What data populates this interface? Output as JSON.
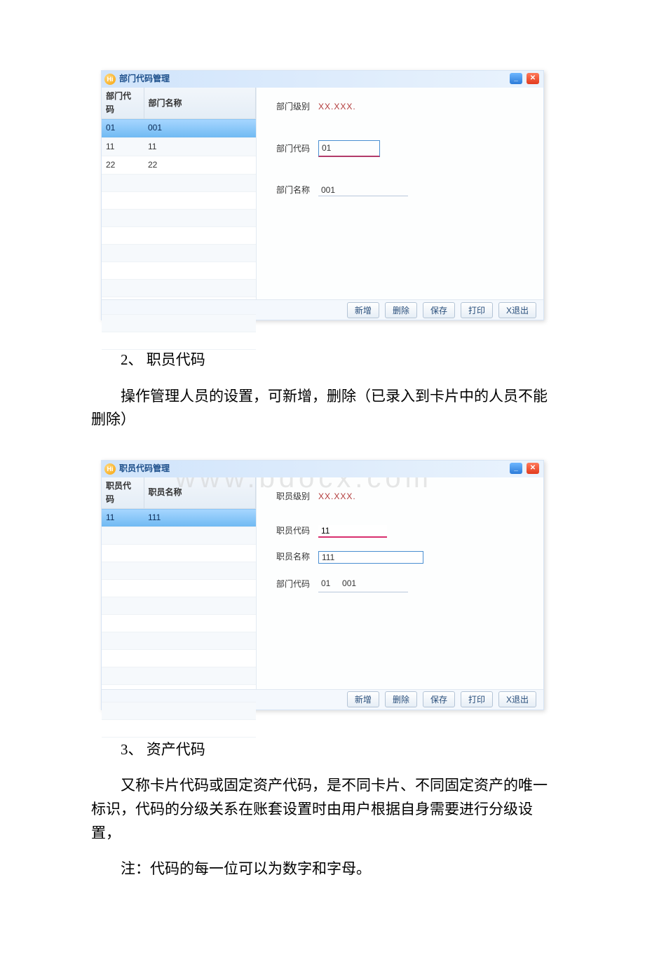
{
  "watermark": "www.bdocx.com",
  "doc": {
    "section2_heading": "2、 职员代码",
    "section2_para": "操作管理人员的设置，可新增，删除（已录入到卡片中的人员不能删除）",
    "section3_heading": "3、 资产代码",
    "section3_para": "又称卡片代码或固定资产代码，是不同卡片、不同固定资产的唯一标识，代码的分级关系在账套设置时由用户根据自身需要进行分级设置，",
    "section3_note": "注：代码的每一位可以为数字和字母。"
  },
  "window1": {
    "title": "部门代码管理",
    "hi_label": "Hi",
    "table": {
      "headers": {
        "code": "部门代码",
        "name": "部门名称"
      },
      "rows": [
        {
          "code": "01",
          "name": "001",
          "selected": true
        },
        {
          "code": "11",
          "name": "11",
          "selected": false
        },
        {
          "code": "22",
          "name": "22",
          "selected": false
        }
      ],
      "empty_rows": 10
    },
    "form": {
      "level_label": "部门级别",
      "level_value": "XX.XXX.",
      "code_label": "部门代码",
      "code_value": "01",
      "name_label": "部门名称",
      "name_value": "001"
    },
    "buttons": {
      "add": "新增",
      "delete": "删除",
      "save": "保存",
      "print": "打印",
      "exit": "X退出"
    }
  },
  "window2": {
    "title": "职员代码管理",
    "hi_label": "Hi",
    "table": {
      "headers": {
        "code": "职员代码",
        "name": "职员名称"
      },
      "rows": [
        {
          "code": "11",
          "name": "111",
          "selected": true
        }
      ],
      "empty_rows": 12
    },
    "form": {
      "level_label": "职员级别",
      "level_value": "XX.XXX.",
      "code_label": "职员代码",
      "code_value": "11",
      "name_label": "职员名称",
      "name_value": "111",
      "dept_label": "部门代码",
      "dept_code": "01",
      "dept_name": "001"
    },
    "buttons": {
      "add": "新增",
      "delete": "删除",
      "save": "保存",
      "print": "打印",
      "exit": "X退出"
    }
  }
}
